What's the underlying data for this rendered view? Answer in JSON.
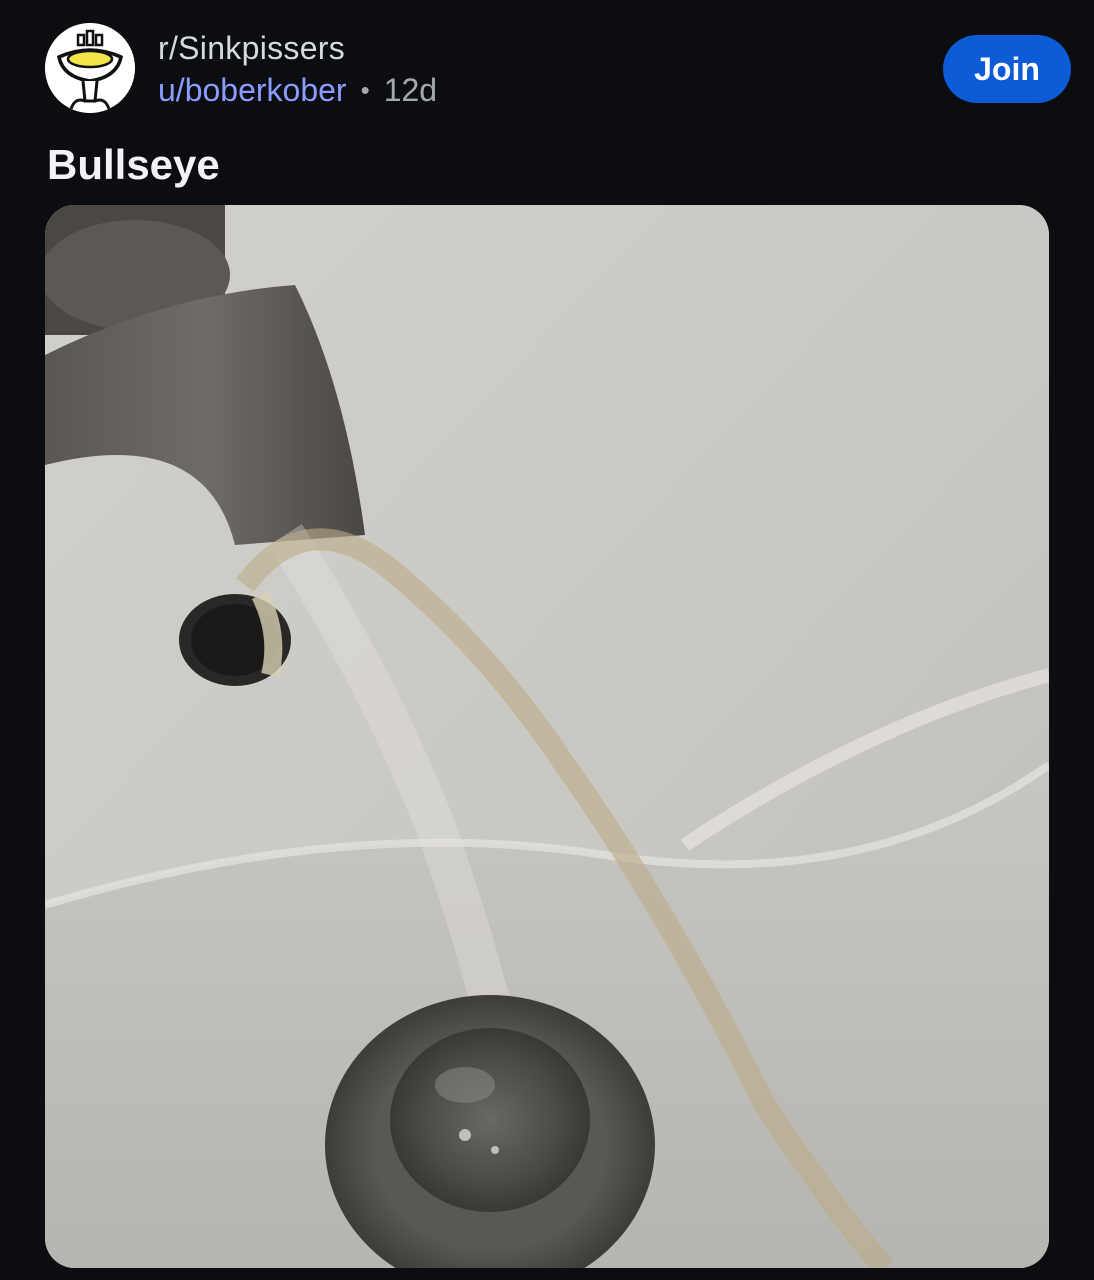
{
  "post": {
    "community": "r/Sinkpissers",
    "author": "u/boberkober",
    "separator": "•",
    "age": "12d",
    "title": "Bullseye",
    "join_label": "Join"
  },
  "media": {
    "icon": "photo-of-sink",
    "alt": "Bullseye"
  },
  "colors": {
    "background": "#0b0d11",
    "join_button": "#0d5bd6",
    "username": "#8a9dff",
    "meta_gray": "#a5a9ad"
  }
}
